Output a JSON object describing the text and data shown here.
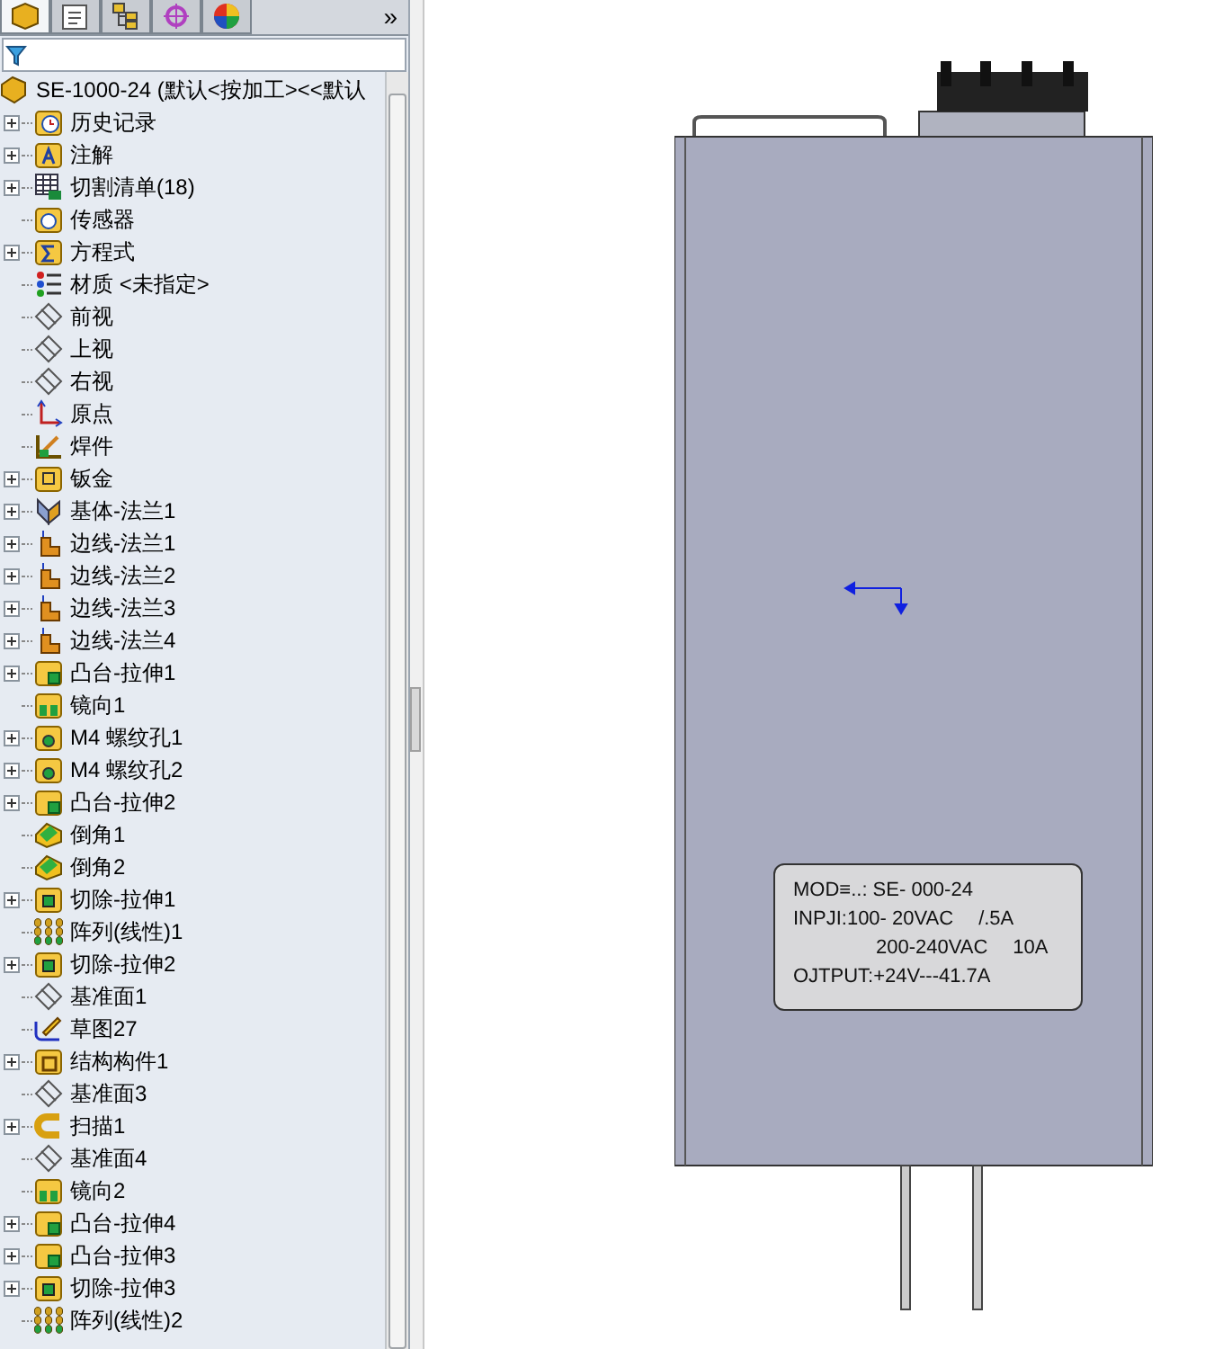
{
  "toolbar": {
    "tabs": [
      {
        "kind": "feature",
        "selected": true
      },
      {
        "kind": "property",
        "selected": false
      },
      {
        "kind": "config",
        "selected": false
      },
      {
        "kind": "dim",
        "selected": false
      },
      {
        "kind": "display",
        "selected": false
      }
    ],
    "more": "»"
  },
  "tree": {
    "root": "SE-1000-24  (默认<按加工><<默认",
    "items": [
      {
        "label": "历史记录",
        "kind": "history",
        "expandable": true
      },
      {
        "label": "注解",
        "kind": "annotations",
        "expandable": true
      },
      {
        "label": "切割清单(18)",
        "kind": "cutlist",
        "expandable": true
      },
      {
        "label": "传感器",
        "kind": "sensor",
        "expandable": false
      },
      {
        "label": "方程式",
        "kind": "equations",
        "expandable": true
      },
      {
        "label": "材质 <未指定>",
        "kind": "material",
        "expandable": false
      },
      {
        "label": "前视",
        "kind": "plane",
        "expandable": false
      },
      {
        "label": "上视",
        "kind": "plane",
        "expandable": false
      },
      {
        "label": "右视",
        "kind": "plane",
        "expandable": false
      },
      {
        "label": "原点",
        "kind": "origin",
        "expandable": false
      },
      {
        "label": "焊件",
        "kind": "weldment",
        "expandable": false
      },
      {
        "label": "钣金",
        "kind": "sheetmetal",
        "expandable": true
      },
      {
        "label": "基体-法兰1",
        "kind": "baseflange",
        "expandable": true
      },
      {
        "label": "边线-法兰1",
        "kind": "edgeflange",
        "expandable": true
      },
      {
        "label": "边线-法兰2",
        "kind": "edgeflange",
        "expandable": true
      },
      {
        "label": "边线-法兰3",
        "kind": "edgeflange",
        "expandable": true
      },
      {
        "label": "边线-法兰4",
        "kind": "edgeflange",
        "expandable": true
      },
      {
        "label": "凸台-拉伸1",
        "kind": "extrude",
        "expandable": true
      },
      {
        "label": "镜向1",
        "kind": "mirror",
        "expandable": false
      },
      {
        "label": "M4 螺纹孔1",
        "kind": "hole",
        "expandable": true
      },
      {
        "label": "M4 螺纹孔2",
        "kind": "hole",
        "expandable": true
      },
      {
        "label": "凸台-拉伸2",
        "kind": "extrude",
        "expandable": true
      },
      {
        "label": "倒角1",
        "kind": "chamfer",
        "expandable": false
      },
      {
        "label": "倒角2",
        "kind": "chamfer",
        "expandable": false
      },
      {
        "label": "切除-拉伸1",
        "kind": "cut",
        "expandable": true
      },
      {
        "label": "阵列(线性)1",
        "kind": "pattern",
        "expandable": false
      },
      {
        "label": "切除-拉伸2",
        "kind": "cut",
        "expandable": true
      },
      {
        "label": "基准面1",
        "kind": "plane",
        "expandable": false
      },
      {
        "label": "草图27",
        "kind": "sketch",
        "expandable": false
      },
      {
        "label": "结构构件1",
        "kind": "structural",
        "expandable": true
      },
      {
        "label": "基准面3",
        "kind": "plane",
        "expandable": false
      },
      {
        "label": "扫描1",
        "kind": "sweep",
        "expandable": true
      },
      {
        "label": "基准面4",
        "kind": "plane",
        "expandable": false
      },
      {
        "label": "镜向2",
        "kind": "mirror",
        "expandable": false
      },
      {
        "label": "凸台-拉伸4",
        "kind": "extrude",
        "expandable": true
      },
      {
        "label": "凸台-拉伸3",
        "kind": "extrude",
        "expandable": true
      },
      {
        "label": "切除-拉伸3",
        "kind": "cut",
        "expandable": true
      },
      {
        "label": "阵列(线性)2",
        "kind": "pattern",
        "expandable": false
      }
    ]
  },
  "model_label": {
    "lines": [
      {
        "text": "MOD≡..: SE- 000-24"
      },
      {
        "text": "INPJI:100- 20VAC",
        "value": "/.5A"
      },
      {
        "text": "200-240VAC",
        "value": "10A"
      },
      {
        "text": "OJTPUT:+24V---41.7A"
      }
    ]
  }
}
